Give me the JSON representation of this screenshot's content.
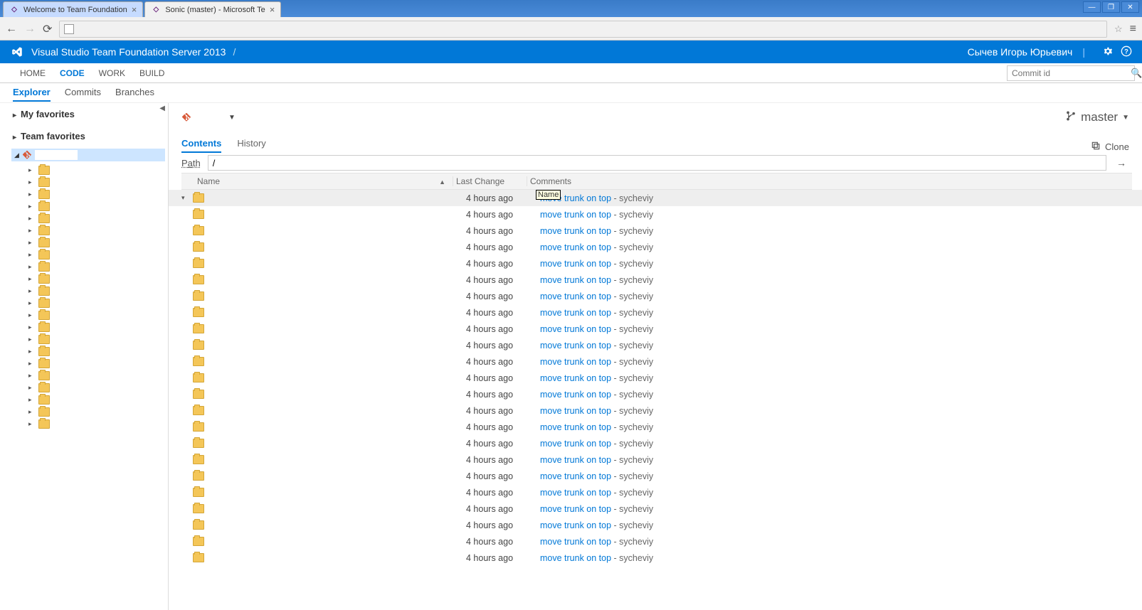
{
  "browser": {
    "tabs": [
      {
        "title": "Welcome to Team Foundation",
        "active": false
      },
      {
        "title": "Sonic (master) - Microsoft Te",
        "active": true
      }
    ]
  },
  "header": {
    "product": "Visual Studio Team Foundation Server 2013",
    "breadcrumb_sep": "/",
    "user": "Сычев Игорь Юрьевич"
  },
  "mainNav": [
    "HOME",
    "CODE",
    "WORK",
    "BUILD"
  ],
  "mainNavActive": "CODE",
  "subNav": [
    "Explorer",
    "Commits",
    "Branches"
  ],
  "subNavActive": "Explorer",
  "commitSearch": {
    "placeholder": "Commit id"
  },
  "sidebar": {
    "favHeaders": [
      "My favorites",
      "Team favorites"
    ],
    "treeRootLabel": "",
    "childCount": 22
  },
  "repo": {
    "branch": "master",
    "contentTabs": [
      "Contents",
      "History"
    ],
    "contentTabActive": "Contents",
    "cloneLabel": "Clone",
    "pathLabel_pre": "P",
    "pathLabel_under": "a",
    "pathLabel_post": "th",
    "pathValue": "/",
    "columns": {
      "name": "Name",
      "last": "Last Change",
      "comments": "Comments"
    },
    "tooltip": "Name",
    "rows": [
      {
        "last": "4 hours ago",
        "commit": "move trunk on top",
        "author": "sycheviy",
        "expanded": true
      },
      {
        "last": "4 hours ago",
        "commit": "move trunk on top",
        "author": "sycheviy"
      },
      {
        "last": "4 hours ago",
        "commit": "move trunk on top",
        "author": "sycheviy"
      },
      {
        "last": "4 hours ago",
        "commit": "move trunk on top",
        "author": "sycheviy"
      },
      {
        "last": "4 hours ago",
        "commit": "move trunk on top",
        "author": "sycheviy"
      },
      {
        "last": "4 hours ago",
        "commit": "move trunk on top",
        "author": "sycheviy"
      },
      {
        "last": "4 hours ago",
        "commit": "move trunk on top",
        "author": "sycheviy"
      },
      {
        "last": "4 hours ago",
        "commit": "move trunk on top",
        "author": "sycheviy"
      },
      {
        "last": "4 hours ago",
        "commit": "move trunk on top",
        "author": "sycheviy"
      },
      {
        "last": "4 hours ago",
        "commit": "move trunk on top",
        "author": "sycheviy"
      },
      {
        "last": "4 hours ago",
        "commit": "move trunk on top",
        "author": "sycheviy"
      },
      {
        "last": "4 hours ago",
        "commit": "move trunk on top",
        "author": "sycheviy"
      },
      {
        "last": "4 hours ago",
        "commit": "move trunk on top",
        "author": "sycheviy"
      },
      {
        "last": "4 hours ago",
        "commit": "move trunk on top",
        "author": "sycheviy"
      },
      {
        "last": "4 hours ago",
        "commit": "move trunk on top",
        "author": "sycheviy"
      },
      {
        "last": "4 hours ago",
        "commit": "move trunk on top",
        "author": "sycheviy"
      },
      {
        "last": "4 hours ago",
        "commit": "move trunk on top",
        "author": "sycheviy"
      },
      {
        "last": "4 hours ago",
        "commit": "move trunk on top",
        "author": "sycheviy"
      },
      {
        "last": "4 hours ago",
        "commit": "move trunk on top",
        "author": "sycheviy"
      },
      {
        "last": "4 hours ago",
        "commit": "move trunk on top",
        "author": "sycheviy"
      },
      {
        "last": "4 hours ago",
        "commit": "move trunk on top",
        "author": "sycheviy"
      },
      {
        "last": "4 hours ago",
        "commit": "move trunk on top",
        "author": "sycheviy"
      },
      {
        "last": "4 hours ago",
        "commit": "move trunk on top",
        "author": "sycheviy"
      }
    ]
  }
}
